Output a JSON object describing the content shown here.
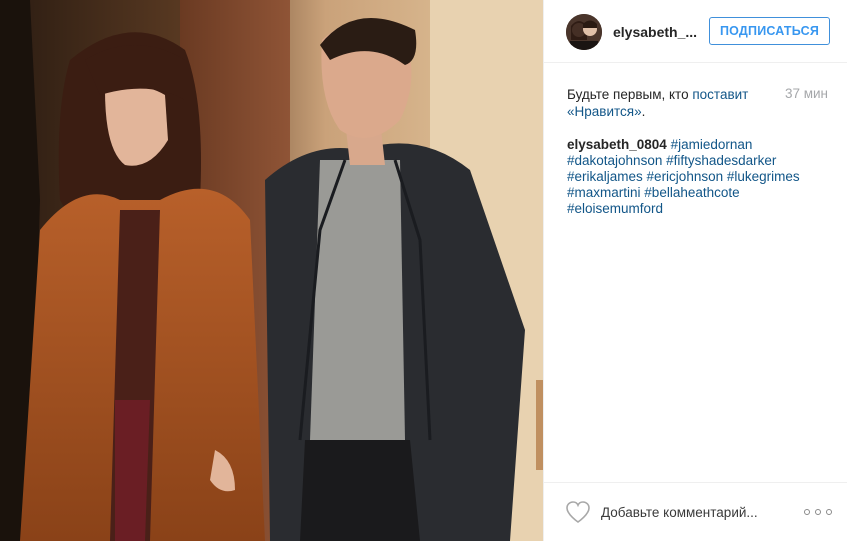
{
  "post": {
    "username": "elysabeth_...",
    "follow_label": "ПОДПИСАТЬСЯ",
    "likes_prefix": "Будьте первым, кто ",
    "likes_link": "поставит «Нравится»",
    "likes_suffix": ".",
    "timestamp": "37 мин",
    "caption_author": "elysabeth_0804",
    "hashtags": [
      "#jamiedornan",
      "#dakotajohnson",
      "#fiftyshadesdarker",
      "#erikaljames",
      "#ericjohnson",
      "#lukegrimes",
      "#maxmartini",
      "#bellaheathcote",
      "#eloisemumford"
    ]
  },
  "comment": {
    "placeholder": "Добавьте комментарий..."
  },
  "icons": {
    "like": "heart-outline-icon",
    "more": "more-options-icon"
  },
  "colors": {
    "accent": "#3897f0",
    "link": "#125688",
    "muted": "#a5a7aa"
  }
}
